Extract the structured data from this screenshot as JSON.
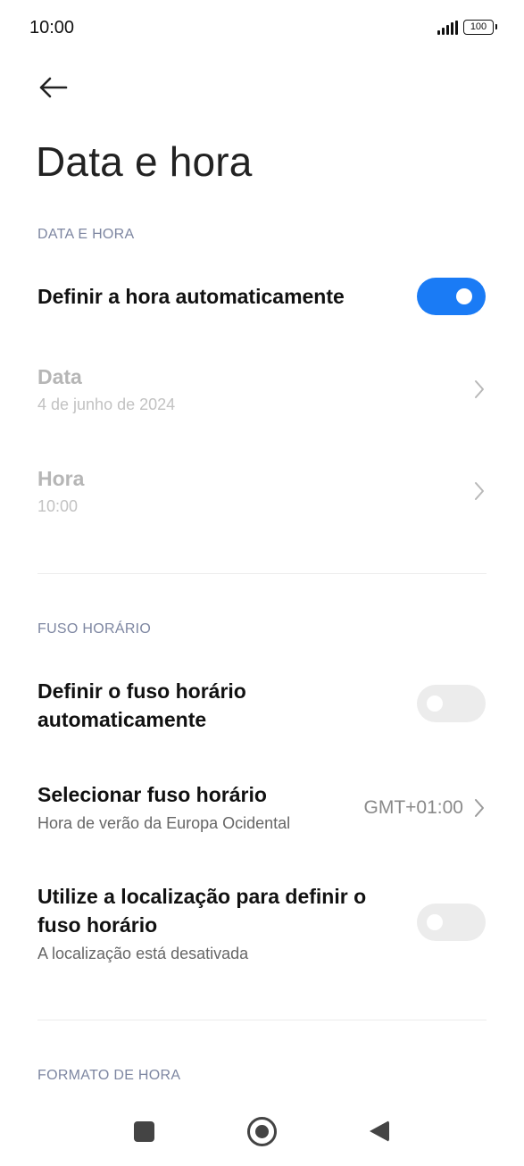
{
  "status_bar": {
    "time": "10:00",
    "battery": "100",
    "icons": [
      "signal-icon",
      "battery-icon"
    ]
  },
  "header": {
    "back_icon": "arrow-left-icon",
    "title": "Data e hora"
  },
  "sections": {
    "date_time": {
      "label": "DATA E HORA",
      "auto_time": {
        "title": "Definir a hora automaticamente",
        "enabled": true
      },
      "date": {
        "title": "Data",
        "value": "4 de junho de 2024"
      },
      "time": {
        "title": "Hora",
        "value": "10:00"
      }
    },
    "timezone": {
      "label": "FUSO HORÁRIO",
      "auto_timezone": {
        "title": "Definir o fuso horário automaticamente",
        "enabled": false
      },
      "select_timezone": {
        "title": "Selecionar fuso horário",
        "subtitle": "Hora de verão da Europa Ocidental",
        "value": "GMT+01:00"
      },
      "use_location": {
        "title": "Utilize a localização para definir o fuso horário",
        "subtitle": "A localização está desativada",
        "enabled": false
      }
    },
    "time_format": {
      "label": "FORMATO DE HORA"
    }
  },
  "colors": {
    "accent": "#1a7bf5",
    "section_label": "#7d86a1",
    "toggle_off": "#ececec"
  },
  "nav_bar": {
    "icons": [
      "recents-square-icon",
      "home-circle-icon",
      "back-triangle-icon"
    ]
  }
}
